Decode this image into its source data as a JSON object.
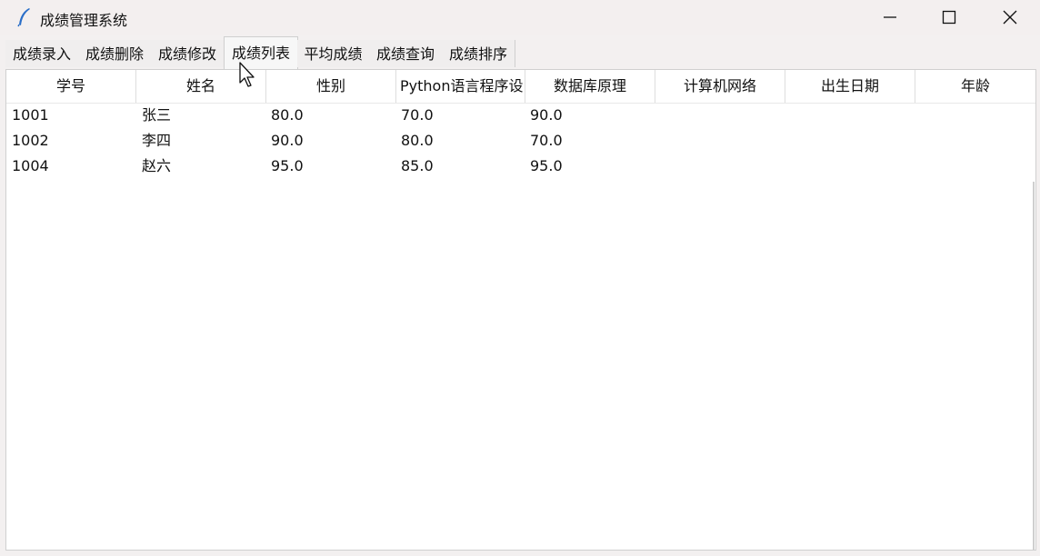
{
  "window": {
    "title": "成绩管理系统",
    "app_icon": "feather-icon",
    "controls": [
      "minimize-icon",
      "maximize-icon",
      "close-icon"
    ]
  },
  "tabs": [
    {
      "label": "成绩录入"
    },
    {
      "label": "成绩删除"
    },
    {
      "label": "成绩修改"
    },
    {
      "label": "成绩列表",
      "active": true
    },
    {
      "label": "平均成绩"
    },
    {
      "label": "成绩查询"
    },
    {
      "label": "成绩排序"
    }
  ],
  "table": {
    "columns": [
      "学号",
      "姓名",
      "性别",
      "Python语言程序设",
      "数据库原理",
      "计算机网络",
      "出生日期",
      "年龄"
    ],
    "rows": [
      [
        "1001",
        "张三",
        "80.0",
        "70.0",
        "90.0",
        "",
        "",
        ""
      ],
      [
        "1002",
        "李四",
        "90.0",
        "80.0",
        "70.0",
        "",
        "",
        ""
      ],
      [
        "1004",
        "赵六",
        "95.0",
        "85.0",
        "95.0",
        "",
        "",
        ""
      ]
    ]
  }
}
